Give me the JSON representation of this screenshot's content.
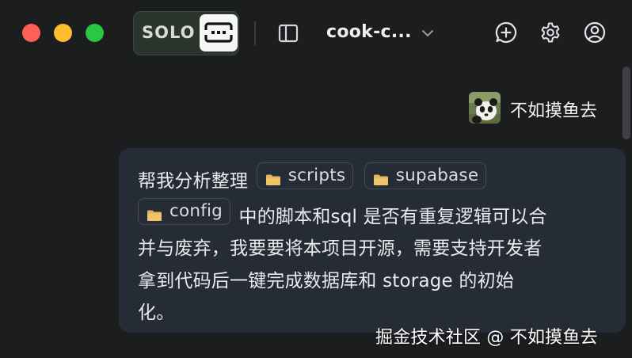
{
  "colors": {
    "background": "#1c1d1f",
    "bubble": "#262c35",
    "traffic_red": "#fe5f57",
    "traffic_yellow": "#febc2e",
    "traffic_green": "#28c840",
    "solo_badge_bg": "#2b352d"
  },
  "titlebar": {
    "mode_badge": {
      "label": "SOLO",
      "icon": "solo-mode-icon"
    },
    "sidebar_toggle_icon": "sidebar-toggle-icon",
    "project_name": "cook-c...",
    "project_dropdown_icon": "chevron-down-icon",
    "actions": [
      {
        "icon": "new-chat-icon"
      },
      {
        "icon": "gear-icon"
      },
      {
        "icon": "user-circle-icon"
      }
    ]
  },
  "message": {
    "user": {
      "name": "不如摸鱼去",
      "avatar_icon": "panda-avatar"
    },
    "segments": {
      "intro": "帮我分析整理",
      "chip1": "scripts",
      "chip2": "supabase",
      "chip3": "config",
      "line2_rest": "中的脚本和sql 是否有重复逻辑可以合",
      "line3": "并与废弃，我要要将本项目开源，需要支持开发者",
      "line4": "拿到代码后一键完成数据库和 storage 的初始",
      "line5": "化。"
    },
    "chip_icon": "folder-icon"
  },
  "watermark": "掘金技术社区 @ 不如摸鱼去"
}
